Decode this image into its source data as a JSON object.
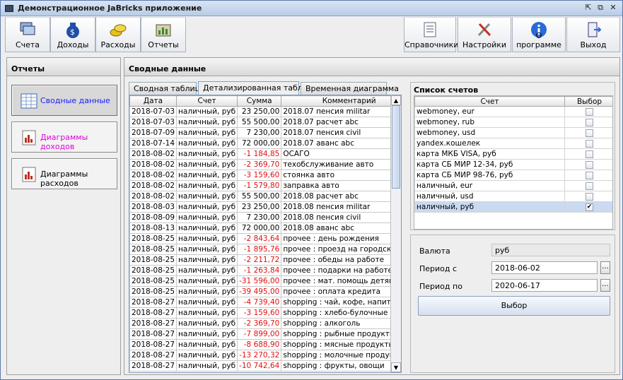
{
  "window": {
    "title": "Демонстрационное JaBricks приложение"
  },
  "toolbar": {
    "left": [
      {
        "label": "Счета",
        "icon": "accounts-icon"
      },
      {
        "label": "Доходы",
        "icon": "money-bag-icon"
      },
      {
        "label": "Расходы",
        "icon": "coins-icon"
      },
      {
        "label": "Отчеты",
        "icon": "reports-icon"
      }
    ],
    "right": [
      {
        "label": "Справочники",
        "icon": "directory-icon"
      },
      {
        "label": "Настройки",
        "icon": "tools-icon"
      },
      {
        "label": "О программе",
        "icon": "info-icon"
      },
      {
        "label": "Выход",
        "icon": "exit-door-icon"
      }
    ]
  },
  "left_panel": {
    "title": "Отчеты",
    "items": [
      {
        "label": "Сводные данные",
        "color": "#1a1aff",
        "active": true
      },
      {
        "label": "Диаграммы доходов",
        "color": "#e000e0",
        "active": false
      },
      {
        "label": "Диаграммы расходов",
        "color": "#000000",
        "active": false
      }
    ]
  },
  "main": {
    "title": "Сводные данные",
    "tabs": [
      "Сводная таблица",
      "Детализированная таблица",
      "Временная диаграмма"
    ],
    "selected_tab": 1,
    "columns": [
      "Дата",
      "Счет",
      "Сумма",
      "Комментарий"
    ],
    "rows": [
      [
        "2018-07-03",
        "наличный, руб",
        "23 250,00",
        "2018.07 пенсия militar"
      ],
      [
        "2018-07-03",
        "наличный, руб",
        "55 500,00",
        "2018.07 расчет abc"
      ],
      [
        "2018-07-09",
        "наличный, руб",
        "7 230,00",
        "2018.07 пенсия civil"
      ],
      [
        "2018-07-14",
        "наличный, руб",
        "72 000,00",
        "2018.07 аванс abc"
      ],
      [
        "2018-08-02",
        "наличный, руб",
        "-1 184,85",
        "ОСАГО"
      ],
      [
        "2018-08-02",
        "наличный, руб",
        "-2 369,70",
        "техобслуживание авто"
      ],
      [
        "2018-08-02",
        "наличный, руб",
        "-3 159,60",
        "стоянка авто"
      ],
      [
        "2018-08-02",
        "наличный, руб",
        "-1 579,80",
        "заправка авто"
      ],
      [
        "2018-08-02",
        "наличный, руб",
        "55 500,00",
        "2018.08 расчет abc"
      ],
      [
        "2018-08-03",
        "наличный, руб",
        "23 250,00",
        "2018.08 пенсия militar"
      ],
      [
        "2018-08-09",
        "наличный, руб",
        "7 230,00",
        "2018.08 пенсия civil"
      ],
      [
        "2018-08-13",
        "наличный, руб",
        "72 000,00",
        "2018.08 аванс abc"
      ],
      [
        "2018-08-25",
        "наличный, руб",
        "-2 843,64",
        "прочее : день рождения"
      ],
      [
        "2018-08-25",
        "наличный, руб",
        "-1 895,76",
        "прочее : проезд на городском т..."
      ],
      [
        "2018-08-25",
        "наличный, руб",
        "-2 211,72",
        "прочее : обеды на работе"
      ],
      [
        "2018-08-25",
        "наличный, руб",
        "-1 263,84",
        "прочее : подарки на работе, до..."
      ],
      [
        "2018-08-25",
        "наличный, руб",
        "-31 596,00",
        "прочее : мат. помощь детям"
      ],
      [
        "2018-08-25",
        "наличный, руб",
        "-39 495,00",
        "прочее : оплата кредита"
      ],
      [
        "2018-08-27",
        "наличный, руб",
        "-4 739,40",
        "shopping : чай, кофе, напитки"
      ],
      [
        "2018-08-27",
        "наличный, руб",
        "-3 159,60",
        "shopping : хлебо-булочные"
      ],
      [
        "2018-08-27",
        "наличный, руб",
        "-2 369,70",
        "shopping : алкоголь"
      ],
      [
        "2018-08-27",
        "наличный, руб",
        "-7 899,00",
        "shopping : рыбные продукты"
      ],
      [
        "2018-08-27",
        "наличный, руб",
        "-8 688,90",
        "shopping : мясные продукты"
      ],
      [
        "2018-08-27",
        "наличный, руб",
        "-13 270,32",
        "shopping : молочные продукты"
      ],
      [
        "2018-08-27",
        "наличный, руб",
        "-10 742,64",
        "shopping : фрукты, овощи"
      ]
    ]
  },
  "accounts": {
    "title": "Список счетов",
    "columns": [
      "Счет",
      "Выбор"
    ],
    "items": [
      {
        "name": "webmoney, eur",
        "checked": false
      },
      {
        "name": "webmoney, rub",
        "checked": false
      },
      {
        "name": "webmoney, usd",
        "checked": false
      },
      {
        "name": "yandex.кошелек",
        "checked": false
      },
      {
        "name": "карта МКБ VISA, руб",
        "checked": false
      },
      {
        "name": "карта СБ МИР 12-34, руб",
        "checked": false
      },
      {
        "name": "карта СБ МИР 98-76, руб",
        "checked": false
      },
      {
        "name": "наличный, eur",
        "checked": false
      },
      {
        "name": "наличный, usd",
        "checked": false
      },
      {
        "name": "наличный, руб",
        "checked": true
      }
    ],
    "selected_index": 9
  },
  "filter": {
    "currency_label": "Валюта",
    "currency_value": "руб",
    "period_from_label": "Период с",
    "period_from_value": "2018-06-02",
    "period_to_label": "Период по",
    "period_to_value": "2020-06-17",
    "dots_label": "...",
    "select_button": "Выбор"
  },
  "colors": {
    "negative": "#e01010",
    "selection": "#c9daf1"
  }
}
